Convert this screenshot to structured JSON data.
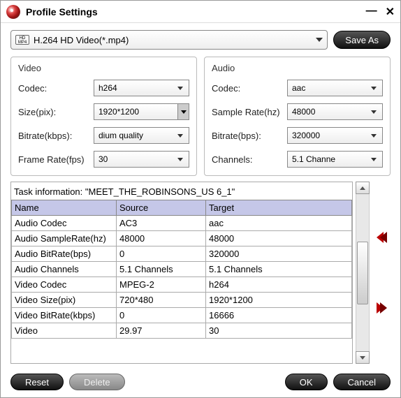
{
  "window": {
    "title": "Profile Settings"
  },
  "profile": {
    "format_icon": "HD MP4",
    "selected": "H.264 HD Video(*.mp4)",
    "save_as": "Save As"
  },
  "video": {
    "title": "Video",
    "codec_label": "Codec:",
    "codec": "h264",
    "size_label": "Size(pix):",
    "size": "1920*1200",
    "bitrate_label": "Bitrate(kbps):",
    "bitrate": "dium quality",
    "fps_label": "Frame Rate(fps)",
    "fps": "30"
  },
  "audio": {
    "title": "Audio",
    "codec_label": "Codec:",
    "codec": "aac",
    "sr_label": "Sample Rate(hz)",
    "sr": "48000",
    "bitrate_label": "Bitrate(bps):",
    "bitrate": "320000",
    "channels_label": "Channels:",
    "channels": "5.1 Channe"
  },
  "task": {
    "info": "Task information: \"MEET_THE_ROBINSONS_US 6_1\"",
    "headers": {
      "name": "Name",
      "source": "Source",
      "target": "Target"
    },
    "rows": [
      {
        "name": "Audio Codec",
        "source": "AC3",
        "target": "aac"
      },
      {
        "name": "Audio SampleRate(hz)",
        "source": "48000",
        "target": "48000"
      },
      {
        "name": "Audio BitRate(bps)",
        "source": "0",
        "target": "320000"
      },
      {
        "name": "Audio Channels",
        "source": "5.1 Channels",
        "target": "5.1 Channels"
      },
      {
        "name": "Video Codec",
        "source": "MPEG-2",
        "target": "h264"
      },
      {
        "name": "Video Size(pix)",
        "source": "720*480",
        "target": "1920*1200"
      },
      {
        "name": "Video BitRate(kbps)",
        "source": "0",
        "target": "16666"
      },
      {
        "name": "Video",
        "source": "29.97",
        "target": "30"
      }
    ]
  },
  "footer": {
    "reset": "Reset",
    "delete": "Delete",
    "ok": "OK",
    "cancel": "Cancel"
  }
}
